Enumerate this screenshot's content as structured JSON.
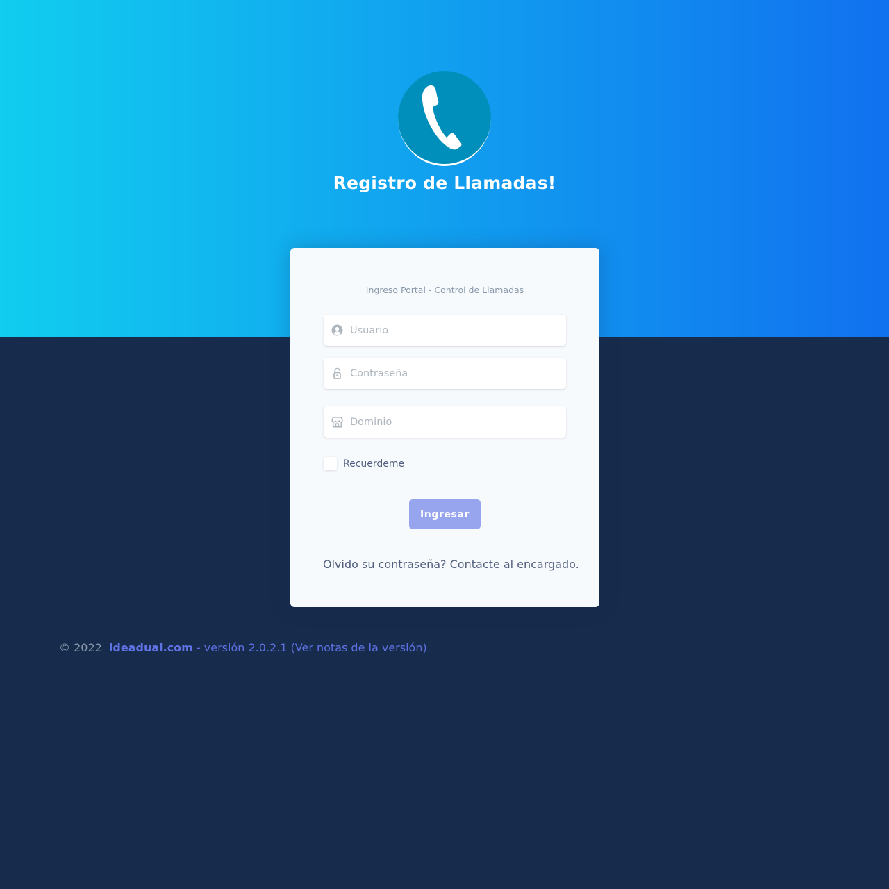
{
  "brand": {
    "title": "Registro de Llamadas!",
    "logo_icon": "phone-icon"
  },
  "card": {
    "subtitle": "Ingreso Portal - Control de Llamadas",
    "username": {
      "placeholder": "Usuario",
      "icon": "user-circle-icon"
    },
    "password": {
      "placeholder": "Contraseña",
      "icon": "lock-icon"
    },
    "domain": {
      "placeholder": "Dominio",
      "icon": "store-icon"
    },
    "remember_label": "Recuerdeme",
    "login_label": "Ingresar",
    "forgot_text": "Olvido su contraseña? Contacte al encargado."
  },
  "footer": {
    "copyright": "© 2022",
    "brand_link": "ideadual.com",
    "version_text": " - versión 2.0.2.1 ",
    "notes_link": "(Ver notas de la versión)"
  },
  "colors": {
    "gradient_start": "#11cdef",
    "gradient_end": "#1171ef",
    "background": "#172b4d",
    "logo_circle": "#008fba",
    "primary_button": "#97a4ee",
    "link": "#5e72e4"
  }
}
